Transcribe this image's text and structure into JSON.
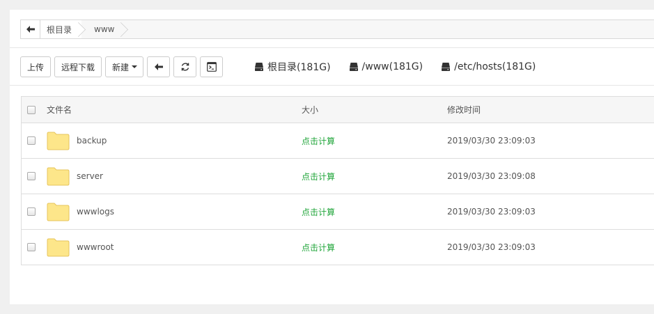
{
  "breadcrumb": {
    "items": [
      {
        "label": "根目录"
      },
      {
        "label": "www"
      }
    ]
  },
  "toolbar": {
    "upload_label": "上传",
    "remote_download_label": "远程下载",
    "new_label": "新建",
    "disks": [
      {
        "label": "根目录(181G)"
      },
      {
        "label": "/www(181G)"
      },
      {
        "label": "/etc/hosts(181G)"
      }
    ]
  },
  "table": {
    "headers": {
      "name": "文件名",
      "size": "大小",
      "time": "修改时间"
    },
    "rows": [
      {
        "name": "backup",
        "size": "点击计算",
        "time": "2019/03/30 23:09:03"
      },
      {
        "name": "server",
        "size": "点击计算",
        "time": "2019/03/30 23:09:08"
      },
      {
        "name": "wwwlogs",
        "size": "点击计算",
        "time": "2019/03/30 23:09:03"
      },
      {
        "name": "wwwroot",
        "size": "点击计算",
        "time": "2019/03/30 23:09:03"
      }
    ]
  },
  "colors": {
    "accent_green": "#20a53a",
    "folder_fill": "#fde68a",
    "folder_stroke": "#e6c45c"
  },
  "icons": [
    "arrow-left-icon",
    "refresh-icon",
    "terminal-icon",
    "hdd-icon",
    "folder-icon"
  ]
}
